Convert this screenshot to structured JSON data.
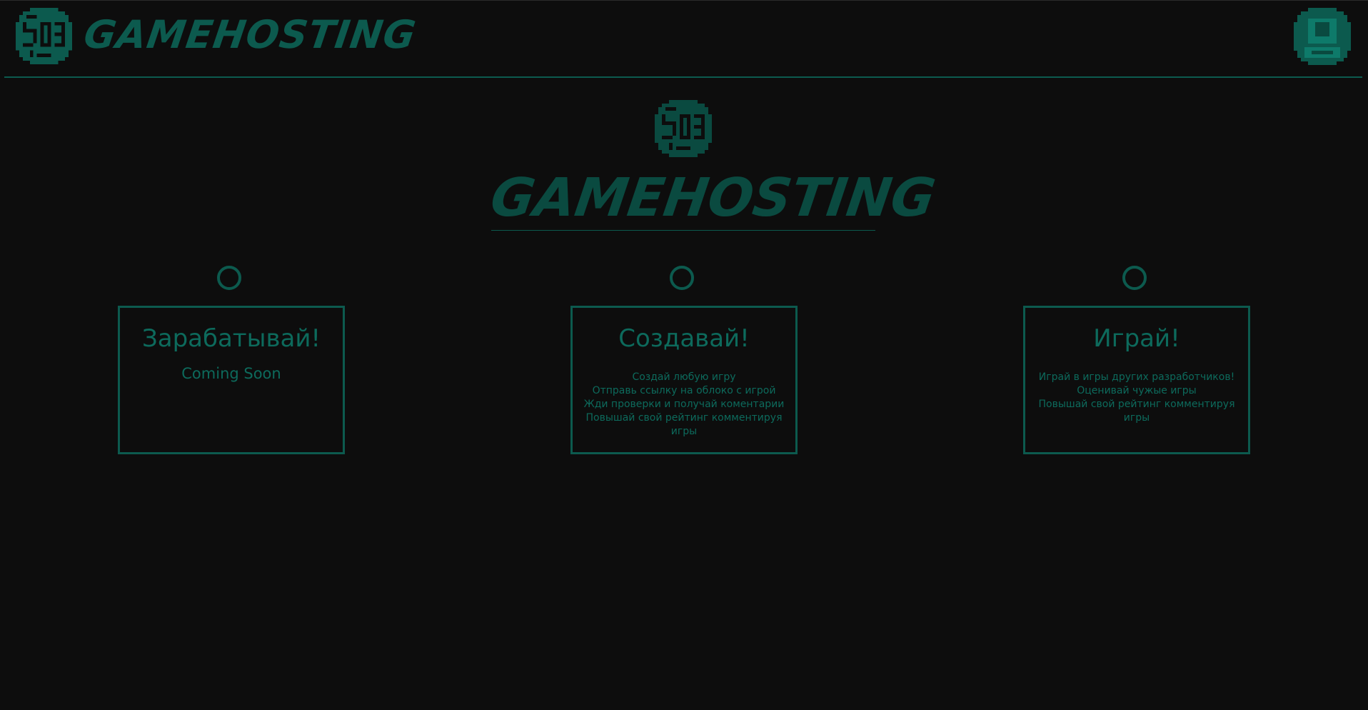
{
  "header": {
    "brand": "GAMEHOSTING",
    "logo_icon": "gamehosting-logo-icon",
    "avatar_icon": "user-avatar-icon"
  },
  "hero": {
    "title": "GAMEHOSTING",
    "logo_icon": "gamehosting-logo-icon"
  },
  "features": [
    {
      "title": "Зарабатывай!",
      "subtitle": "Coming Soon",
      "lines": []
    },
    {
      "title": "Создавай!",
      "subtitle": "",
      "lines": [
        "Создай любую игру",
        "Отправь ссылку на облоко с игрой",
        "Жди проверки и получай коментарии",
        "Повышай свой рейтинг комментируя",
        "игры"
      ]
    },
    {
      "title": "Играй!",
      "subtitle": "",
      "lines": [
        "Играй в игры других разработчиков!",
        "Оценивай чужые игры",
        "Повышай свой рейтинг комментируя",
        "игры"
      ]
    }
  ],
  "colors": {
    "background": "#0d0d0d",
    "accent": "#0c5a4e",
    "text": "#0d6a5c"
  }
}
